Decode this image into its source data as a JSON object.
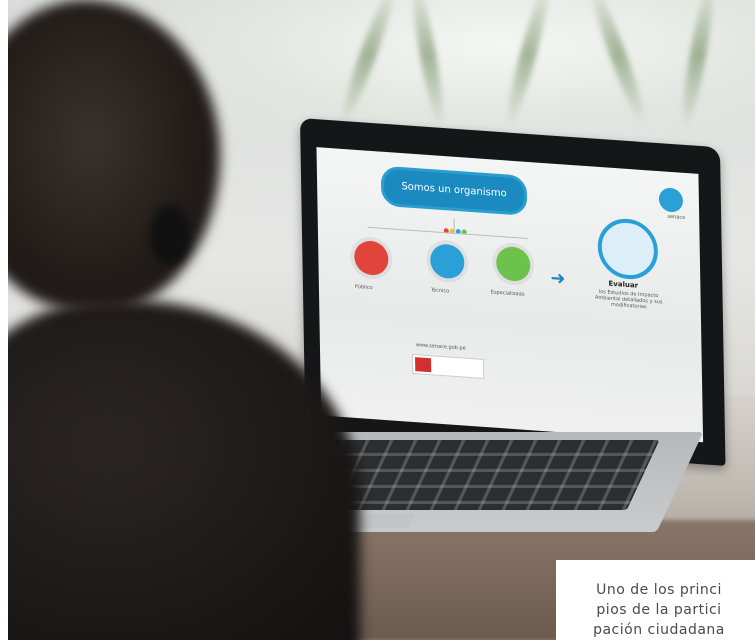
{
  "photo": {
    "subject": "person-with-headphones-watching-laptop",
    "screen": {
      "pill_text": "Somos un organismo",
      "evaluate_title": "Evaluar",
      "evaluate_body": "los Estudios de Impacto Ambiental detallados y sus modificatorias",
      "items": [
        "Público",
        "Técnico",
        "Especializado"
      ],
      "url": "www.senace.gob.pe",
      "logo_label": "senace"
    }
  },
  "caption": {
    "line1": "Uno de los princi",
    "line2": "pios de la partici",
    "line3": "pación ciudadana"
  },
  "colors": {
    "accent_blue": "#1a8ac0",
    "red": "#e0443a",
    "green": "#6cc24a",
    "text": "#4a4a4a"
  }
}
